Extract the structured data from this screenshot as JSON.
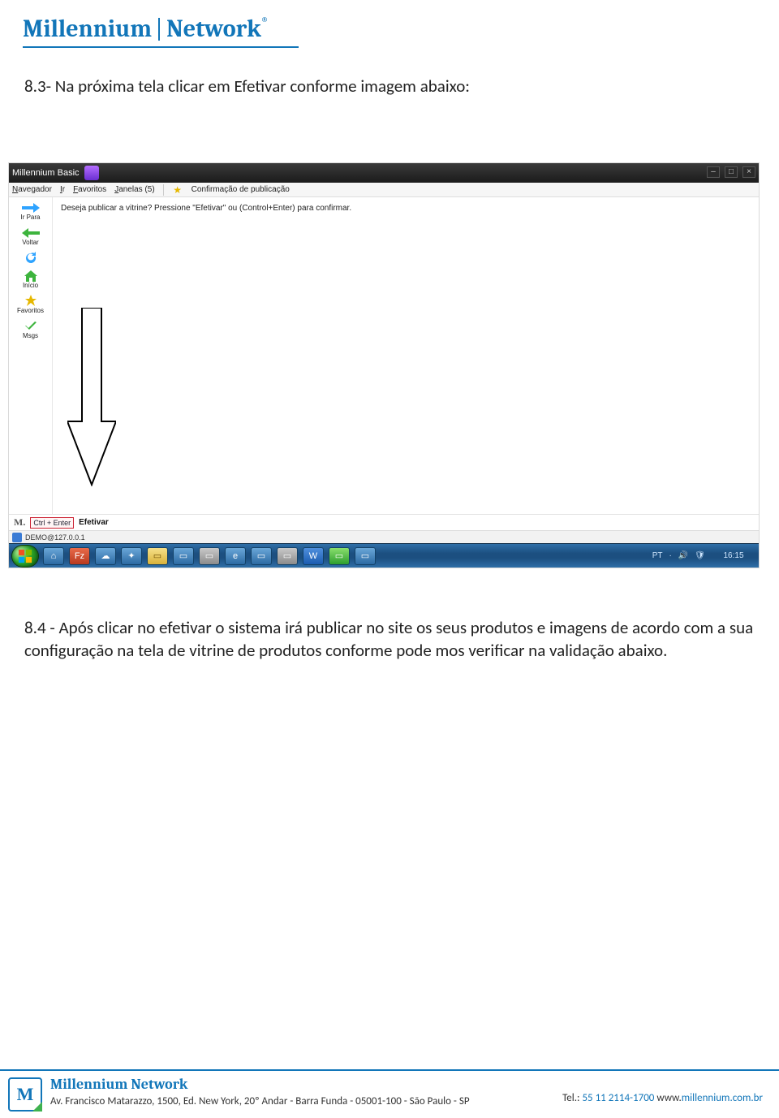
{
  "header": {
    "brand_main": "Millennium",
    "brand_sub": "Network",
    "reg_mark": "®"
  },
  "sections": {
    "s83": "8.3- Na próxima tela clicar em Efetivar conforme  imagem abaixo:",
    "s84": "8.4 - Após clicar no efetivar o sistema irá publicar no site os seus produtos e imagens de acordo com a sua configuração na tela de vitrine de produtos conforme pode mos verificar na validação abaixo."
  },
  "screenshot": {
    "app_name_html": "Millennium Basic",
    "menubar": {
      "items": [
        "Navegador",
        "Ir",
        "Favoritos",
        "Janelas (5)"
      ],
      "tab_title": "Confirmação de publicação"
    },
    "toolbar": [
      {
        "label": "Ir Para",
        "icon": "arrow-right-blue"
      },
      {
        "label": "Voltar",
        "icon": "arrow-left-green"
      },
      {
        "label": "",
        "icon": "refresh"
      },
      {
        "label": "Início",
        "icon": "home"
      },
      {
        "label": "Favoritos",
        "icon": "star"
      },
      {
        "label": "Msgs",
        "icon": "check"
      }
    ],
    "main_message": "Deseja publicar a vitrine? Pressione \"Efetivar\" ou (Control+Enter) para confirmar.",
    "shortcut": {
      "accel": "Ctrl + Enter",
      "label": "Efetivar"
    },
    "status": "DEMO@127.0.0.1",
    "taskbar": {
      "lang": "PT",
      "clock": "16:15"
    }
  },
  "footer": {
    "company": "Millennium Network",
    "address": "Av. Francisco Matarazzo, 1500, Ed. New York, 20º Andar  - Barra Funda - 05001-100 - São Paulo - SP",
    "tel_prefix": "Tel.: ",
    "tel_number": "55 11 2114-1700",
    "site_prefix": " www.",
    "site": "millennium.com.br"
  }
}
